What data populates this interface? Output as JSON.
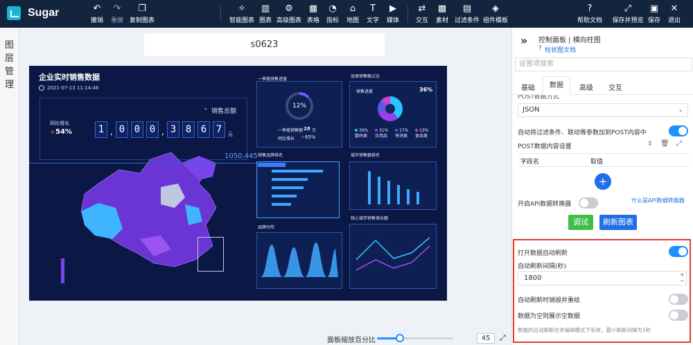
{
  "app": {
    "name": "Sugar"
  },
  "toolbar": {
    "left": [
      {
        "label": "撤销",
        "icon": "undo-icon"
      },
      {
        "label": "重做",
        "icon": "redo-icon"
      },
      {
        "label": "复制图表",
        "icon": "copy-icon"
      }
    ],
    "center": [
      {
        "label": "智能图表",
        "icon": "magic-chart-icon"
      },
      {
        "label": "图表",
        "icon": "bar-chart-icon"
      },
      {
        "label": "高级图表",
        "icon": "advanced-chart-icon"
      },
      {
        "label": "表格",
        "icon": "table-icon"
      },
      {
        "label": "指标",
        "icon": "gauge-icon"
      },
      {
        "label": "地图",
        "icon": "map-icon"
      },
      {
        "label": "文字",
        "icon": "text-icon"
      },
      {
        "label": "媒体",
        "icon": "media-icon"
      },
      {
        "label": "交互",
        "icon": "interaction-icon"
      },
      {
        "label": "素材",
        "icon": "material-icon"
      },
      {
        "label": "过滤条件",
        "icon": "filter-icon"
      },
      {
        "label": "组件模板",
        "icon": "template-icon"
      }
    ],
    "right": [
      {
        "label": "帮助文档",
        "icon": "help-icon"
      },
      {
        "label": "保存并预览",
        "icon": "expand-icon"
      },
      {
        "label": "保存",
        "icon": "save-icon"
      },
      {
        "label": "退出",
        "icon": "close-icon"
      }
    ]
  },
  "leftbar": {
    "label": "图层管理"
  },
  "canvas": {
    "page_name": "s0623",
    "zoom_label": "面板缩放百分比",
    "zoom_value": "45",
    "zoom_fraction": 0.3
  },
  "dashboard": {
    "title": "企业实时销售数据",
    "datetime": "2021-07-13 11:14:46",
    "sales_label": "销售总额",
    "yoy_label": "同比增长",
    "yoy_value": "54%",
    "digits": [
      "1",
      "0",
      "0",
      "0",
      "3",
      "8",
      "6",
      "7"
    ],
    "separators": [
      ",",
      ","
    ],
    "unit": "元",
    "map_value": "1050,445",
    "panels": {
      "progress": "一季度销售进度",
      "share": "品类销售额占比",
      "brand": "销售品牌排名",
      "city": "城市销售额排名",
      "dist": "品牌分布",
      "growth": "核心城市销售增长额"
    },
    "progress_pct": "12%",
    "progress_text": "一季度销售额",
    "progress_num": "28",
    "progress_unit": "万",
    "progress_yoy": "同比增长",
    "progress_yoy_val": "65%",
    "share_label": "销售进度",
    "share_pct": "36%",
    "share_items": [
      {
        "pct": "39%",
        "name": "数码类"
      },
      {
        "pct": "31%",
        "name": "日用品"
      },
      {
        "pct": "17%",
        "name": "快消类"
      },
      {
        "pct": "13%",
        "name": "食品类"
      }
    ]
  },
  "panel": {
    "title": "控制面板 | 横向柱图",
    "doc_link": "柱状图文档",
    "search_placeholder": "设置项搜索",
    "tabs": [
      "基础",
      "数据",
      "高级",
      "交互"
    ],
    "active_tab": 1,
    "post_method_label": "POST数据方式",
    "post_method_value": "JSON",
    "auto_filter_label": "自动将过滤条件、联动等参数加到POST内容中",
    "post_content_label": "POST数据内容设置",
    "table_headers": [
      "字段名",
      "取值"
    ],
    "api_transform_label": "开启API数据转换器",
    "api_transform_link": "什么是API数据转换器",
    "debug_btn": "调试",
    "refresh_btn": "刷新图表",
    "auto_refresh_label": "打开数据自动刷新",
    "interval_label": "自动刷新间隔(秒)",
    "interval_value": "1800",
    "redraw_label": "自动刷新时销毁并重绘",
    "empty_label": "数据为空则展示空数据",
    "note": "数据的自动刷新在非编辑模式下有效，最小刷新间隔为1秒"
  }
}
